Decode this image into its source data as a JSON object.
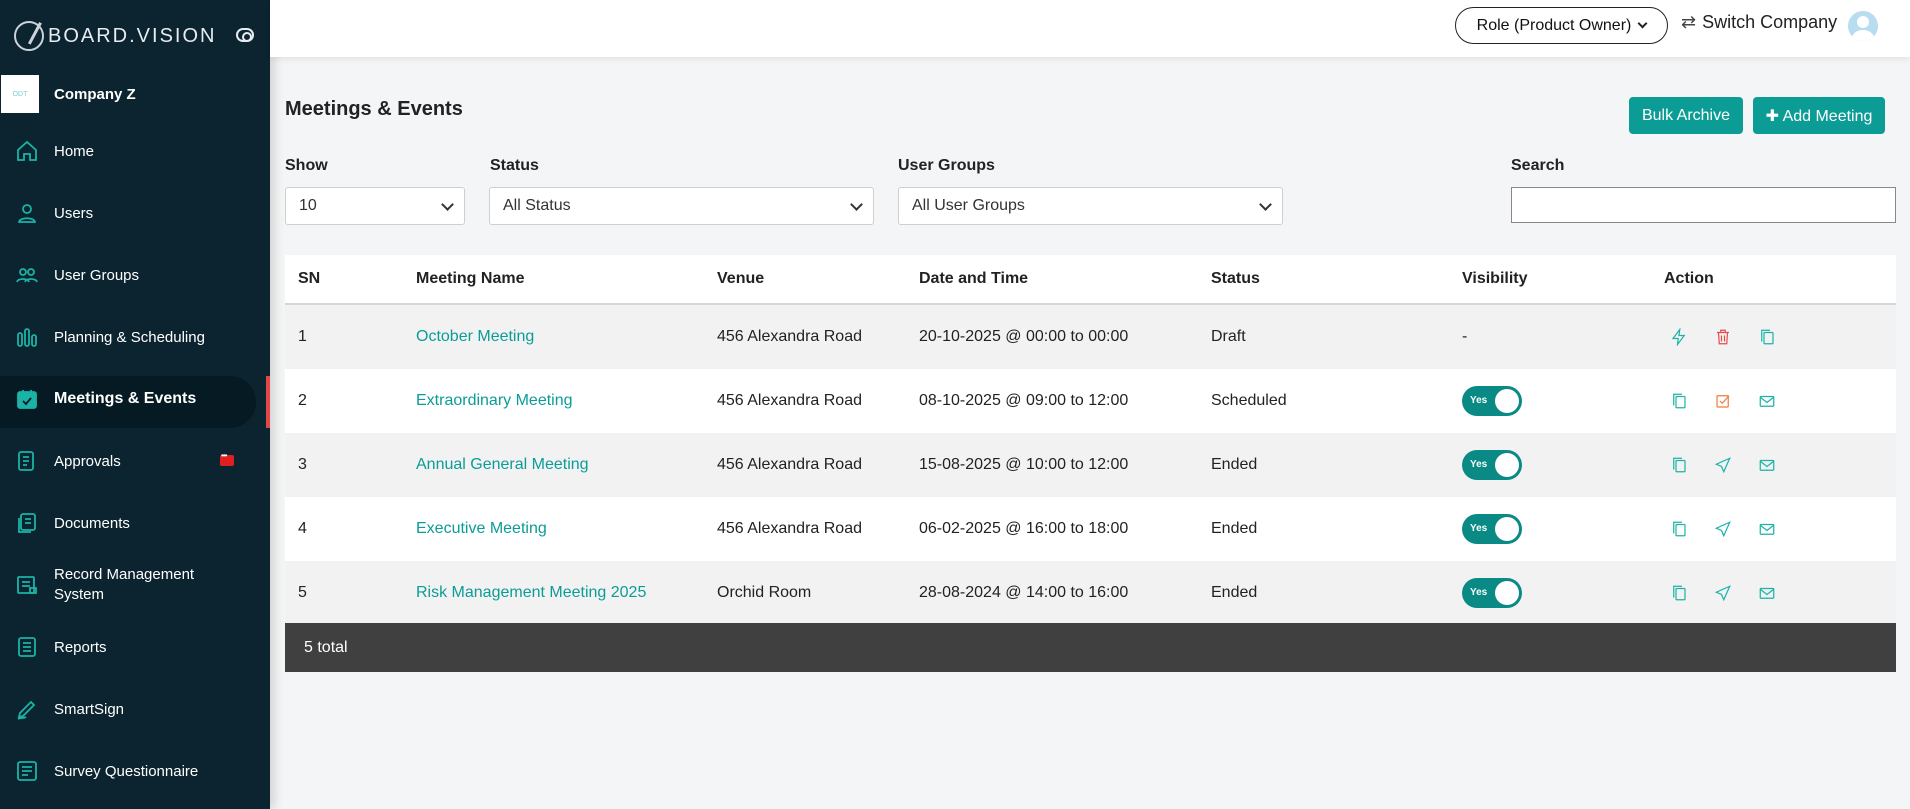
{
  "brand": {
    "name": "BOARD.VISION"
  },
  "company": {
    "name": "Company Z",
    "logo_text": "ODT"
  },
  "sidebar": {
    "items": [
      {
        "label": "Home",
        "icon": "home-icon"
      },
      {
        "label": "Users",
        "icon": "user-icon"
      },
      {
        "label": "User Groups",
        "icon": "users-icon"
      },
      {
        "label": "Planning & Scheduling",
        "icon": "chart-icon"
      },
      {
        "label": "Meetings & Events",
        "icon": "calendar-icon",
        "active": true
      },
      {
        "label": "Approvals",
        "icon": "approvals-icon"
      },
      {
        "label": "Documents",
        "icon": "documents-icon"
      },
      {
        "label": "Record Management System",
        "icon": "records-icon"
      },
      {
        "label": "Reports",
        "icon": "reports-icon"
      },
      {
        "label": "SmartSign",
        "icon": "pen-icon"
      },
      {
        "label": "Survey Questionnaire",
        "icon": "survey-icon"
      }
    ]
  },
  "topbar": {
    "role_label": "Role (Product Owner)",
    "switch_label": "Switch Company"
  },
  "page": {
    "title": "Meetings & Events",
    "bulk_archive": "Bulk Archive",
    "add_meeting": "Add Meeting"
  },
  "filters": {
    "show_label": "Show",
    "show_value": "10",
    "status_label": "Status",
    "status_value": "All Status",
    "groups_label": "User Groups",
    "groups_value": "All User Groups",
    "search_label": "Search",
    "search_value": ""
  },
  "table": {
    "headers": [
      "SN",
      "Meeting Name",
      "Venue",
      "Date and Time",
      "Status",
      "Visibility",
      "Action"
    ],
    "rows": [
      {
        "sn": "1",
        "name": "October Meeting",
        "venue": "456 Alexandra Road",
        "date": "20-10-2025 @ 00:00 to 00:00",
        "status": "Draft",
        "visibility": "-"
      },
      {
        "sn": "2",
        "name": "Extraordinary Meeting",
        "venue": "456 Alexandra Road",
        "date": "08-10-2025 @ 09:00 to 12:00",
        "status": "Scheduled",
        "visibility": "Yes"
      },
      {
        "sn": "3",
        "name": "Annual General Meeting",
        "venue": "456 Alexandra Road",
        "date": "15-08-2025 @ 10:00 to 12:00",
        "status": "Ended",
        "visibility": "Yes"
      },
      {
        "sn": "4",
        "name": "Executive Meeting",
        "venue": "456 Alexandra Road",
        "date": "06-02-2025 @ 16:00 to 18:00",
        "status": "Ended",
        "visibility": "Yes"
      },
      {
        "sn": "5",
        "name": "Risk Management Meeting 2025",
        "venue": "Orchid Room",
        "date": "28-08-2024 @ 14:00 to 16:00",
        "status": "Ended",
        "visibility": "Yes"
      }
    ],
    "total": "5 total"
  },
  "colors": {
    "accent": "#0c9c96",
    "sidebar_bg": "#0b2430",
    "danger": "#e24b4b"
  }
}
